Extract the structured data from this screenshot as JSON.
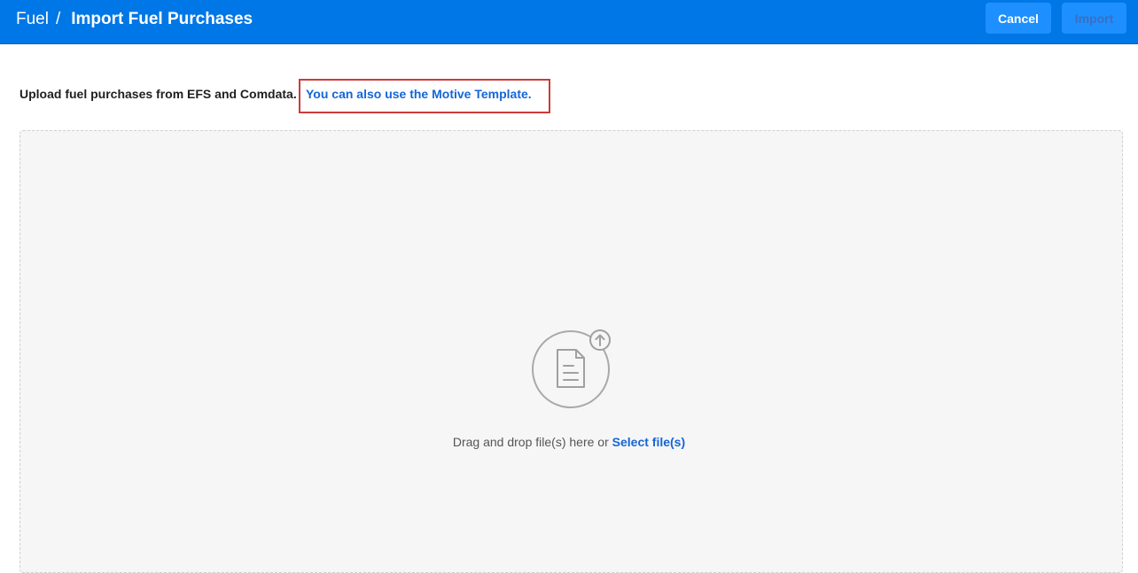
{
  "header": {
    "breadcrumb_root": "Fuel",
    "breadcrumb_separator": "/",
    "page_title": "Import Fuel Purchases",
    "cancel_label": "Cancel",
    "import_label": "Import"
  },
  "intro": {
    "text": "Upload fuel purchases from EFS and Comdata.",
    "template_link": "You can also use the Motive Template."
  },
  "dropzone": {
    "icon": "file-upload-icon",
    "text": "Drag and drop file(s) here or",
    "select_link": "Select file(s)"
  },
  "colors": {
    "header_bg": "#0077e6",
    "button_bg": "#1e8fff",
    "link": "#1466d6",
    "highlight_box": "#cc3b3b",
    "dropzone_bg": "#f6f6f6"
  }
}
